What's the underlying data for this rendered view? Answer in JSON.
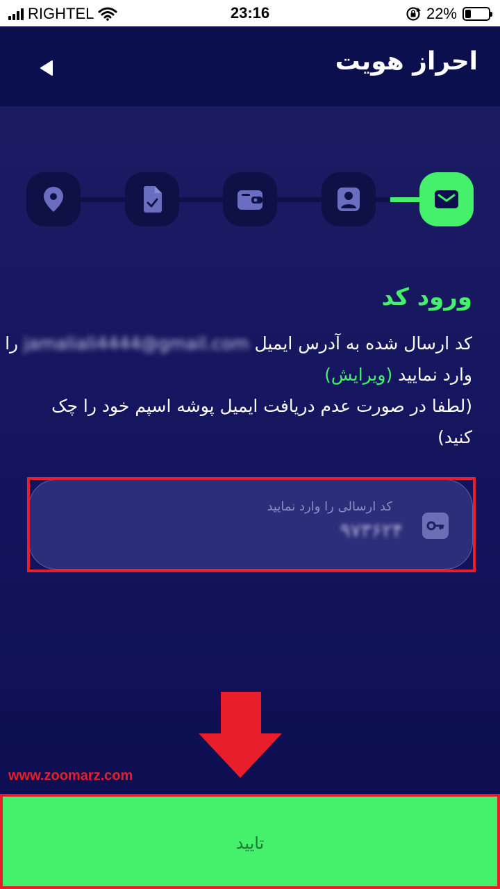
{
  "status_bar": {
    "carrier": "RIGHTEL",
    "time": "23:16",
    "battery": "22%",
    "battery_level": 0.22,
    "icons": [
      "signal-icon",
      "wifi-icon",
      "rotation-lock-icon",
      "battery-icon"
    ]
  },
  "header": {
    "title": "احراز هویت",
    "back_icon": "back-arrow-icon"
  },
  "stepper": {
    "steps": [
      {
        "icon": "location-pin-icon",
        "active": false
      },
      {
        "icon": "document-check-icon",
        "active": false
      },
      {
        "icon": "wallet-icon",
        "active": false
      },
      {
        "icon": "user-id-icon",
        "active": false
      },
      {
        "icon": "email-icon",
        "active": true
      }
    ]
  },
  "content": {
    "title": "ورود کد",
    "desc_prefix": "کد ارسال شده به آدرس ایمیل",
    "email": "jamaliali4444@gmail.com",
    "desc_suffix": "را",
    "line2_text": "وارد نمایید",
    "edit_link": "(ویرایش)",
    "line3": "(لطفا در صورت عدم دریافت ایمیل پوشه اسپم خود را چک",
    "line4": "کنید)"
  },
  "code_input": {
    "label": "کد ارسالی را وارد نمایید",
    "value": "۹۷۳۶۲۴",
    "icon": "key-icon"
  },
  "annotation": {
    "watermark": "www.zoomarz.com",
    "arrow_color": "#e81f2a"
  },
  "confirm_button": {
    "label": "تایید"
  },
  "colors": {
    "accent": "#45f06a",
    "background": "#161660",
    "header": "#0c0f4d",
    "highlight": "#e81f2a"
  }
}
